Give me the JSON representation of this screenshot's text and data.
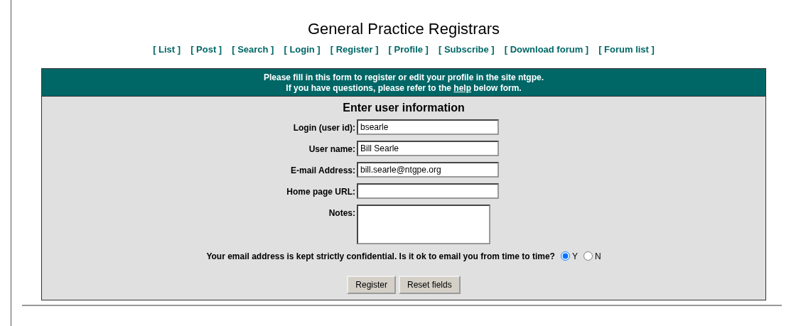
{
  "title": "General Practice Registrars",
  "nav": [
    "[ List ]",
    "[ Post ]",
    "[ Search ]",
    "[ Login ]",
    "[ Register ]",
    "[ Profile ]",
    "[ Subscribe ]",
    "[ Download forum ]",
    "[ Forum list ]"
  ],
  "intro": {
    "line_1": "Please fill in this form to register or edit your profile in the site ntgpe.",
    "line_2_before": "If you have questions, please refer to the",
    "line_2_link": "help",
    "line_2_after": "below form."
  },
  "form": {
    "heading": "Enter user information",
    "fields": [
      {
        "kind": "text",
        "label": "Login (user id):",
        "value": "bsearle"
      },
      {
        "kind": "text",
        "label": "User name:",
        "value": "Bill Searle"
      },
      {
        "kind": "text",
        "label": "E-mail Address:",
        "value": "bill.searle@ntgpe.org"
      },
      {
        "kind": "text",
        "label": "Home page URL:"
      },
      {
        "kind": "textarea",
        "label": "Notes:"
      }
    ],
    "email_question": "Your email address is kept strictly confidential. Is it ok to email you from time to time?",
    "email_options": [
      {
        "label": "Y",
        "selected": true
      },
      {
        "label": "N",
        "selected": false
      }
    ],
    "buttons": [
      "Register",
      "Reset fields"
    ]
  }
}
